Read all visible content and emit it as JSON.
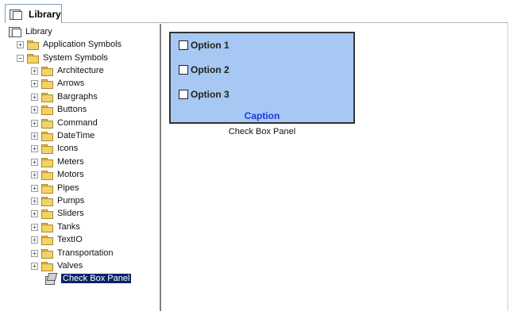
{
  "tab": {
    "label": "Library"
  },
  "tree": {
    "root": "Library",
    "items": [
      {
        "label": "Application Symbols",
        "expander": "+",
        "level": 1
      },
      {
        "label": "System Symbols",
        "expander": "−",
        "level": 1
      },
      {
        "label": "Architecture",
        "expander": "+",
        "level": 2
      },
      {
        "label": "Arrows",
        "expander": "+",
        "level": 2
      },
      {
        "label": "Bargraphs",
        "expander": "+",
        "level": 2
      },
      {
        "label": "Buttons",
        "expander": "+",
        "level": 2
      },
      {
        "label": "Command",
        "expander": "+",
        "level": 2
      },
      {
        "label": "DateTime",
        "expander": "+",
        "level": 2
      },
      {
        "label": "Icons",
        "expander": "+",
        "level": 2
      },
      {
        "label": "Meters",
        "expander": "+",
        "level": 2
      },
      {
        "label": "Motors",
        "expander": "+",
        "level": 2
      },
      {
        "label": "Pipes",
        "expander": "+",
        "level": 2
      },
      {
        "label": "Pumps",
        "expander": "+",
        "level": 2
      },
      {
        "label": "Sliders",
        "expander": "+",
        "level": 2
      },
      {
        "label": "Tanks",
        "expander": "+",
        "level": 2
      },
      {
        "label": "TextIO",
        "expander": "+",
        "level": 2
      },
      {
        "label": "Transportation",
        "expander": "+",
        "level": 2
      },
      {
        "label": "Valves",
        "expander": "+",
        "level": 2
      }
    ],
    "selected": "Check Box Panel"
  },
  "preview": {
    "options": [
      "Option 1",
      "Option 2",
      "Option 3"
    ],
    "caption": "Caption",
    "name": "Check Box Panel"
  },
  "colors": {
    "panel_bg": "#a7c8f2",
    "caption_text": "#1a39e0",
    "selection": "#0a246a"
  }
}
